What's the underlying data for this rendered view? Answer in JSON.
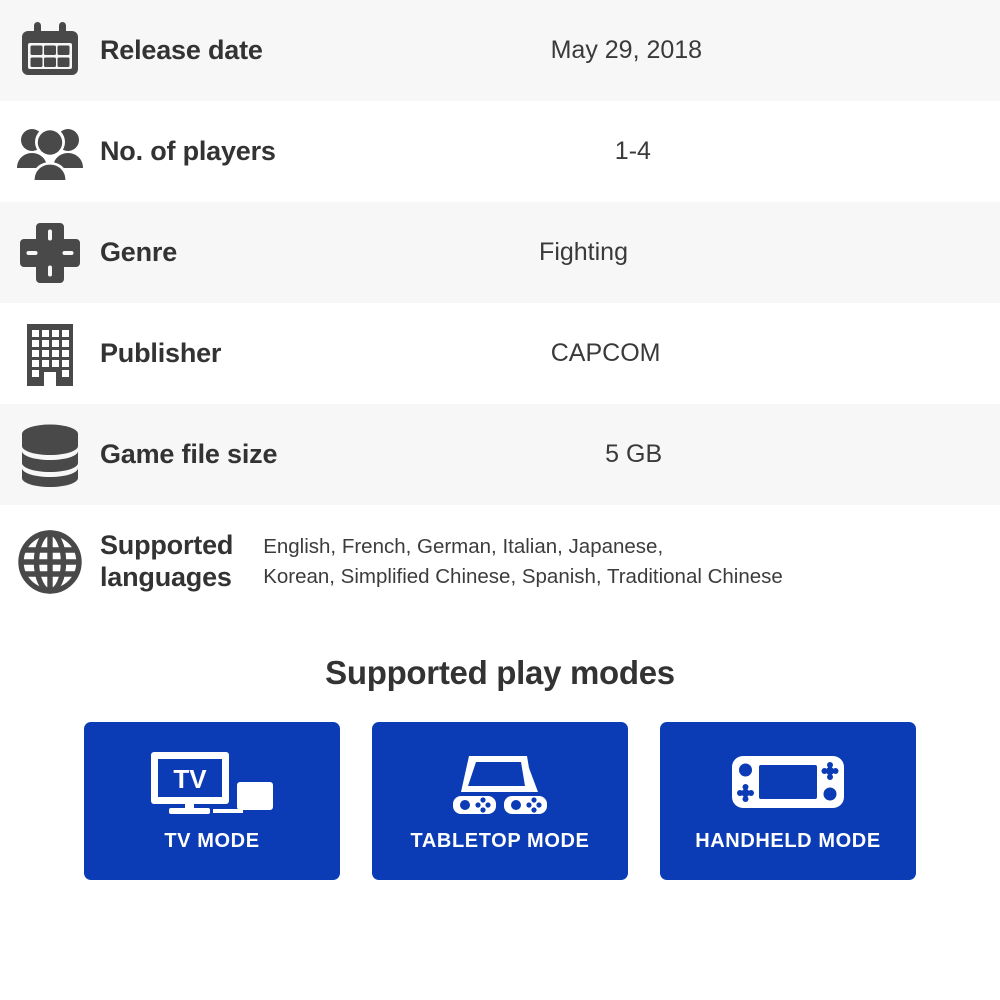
{
  "spec_rows": [
    {
      "icon": "calendar-icon",
      "label": "Release date",
      "value": "May 29, 2018",
      "shaded": true
    },
    {
      "icon": "players-icon",
      "label": "No. of players",
      "value": "1-4",
      "shaded": false
    },
    {
      "icon": "dpad-icon",
      "label": "Genre",
      "value": "Fighting",
      "shaded": true
    },
    {
      "icon": "building-icon",
      "label": "Publisher",
      "value": "CAPCOM",
      "shaded": false
    },
    {
      "icon": "database-icon",
      "label": "Game file size",
      "value": "5 GB",
      "shaded": true
    }
  ],
  "languages_row": {
    "icon": "globe-icon",
    "label_line1": "Supported",
    "label_line2": "languages",
    "value_line1": "English, French, German, Italian, Japanese,",
    "value_line2": "Korean, Simplified Chinese, Spanish, Traditional Chinese",
    "value_full": "English, French, German, Italian, Japanese, Korean, Simplified Chinese, Spanish, Traditional Chinese"
  },
  "play_modes": {
    "title": "Supported play modes",
    "cards": [
      {
        "art": "tv-mode-icon",
        "label": "TV MODE",
        "screen_text": "TV"
      },
      {
        "art": "tabletop-mode-icon",
        "label": "TABLETOP MODE"
      },
      {
        "art": "handheld-mode-icon",
        "label": "HANDHELD MODE"
      }
    ]
  },
  "colors": {
    "accent_blue": "#0B3CB5",
    "row_shade": "#F7F7F7",
    "row_plain": "#FFFFFF",
    "icon_gray": "#494949",
    "label_text": "#333333",
    "value_text": "#3A3A3A"
  }
}
